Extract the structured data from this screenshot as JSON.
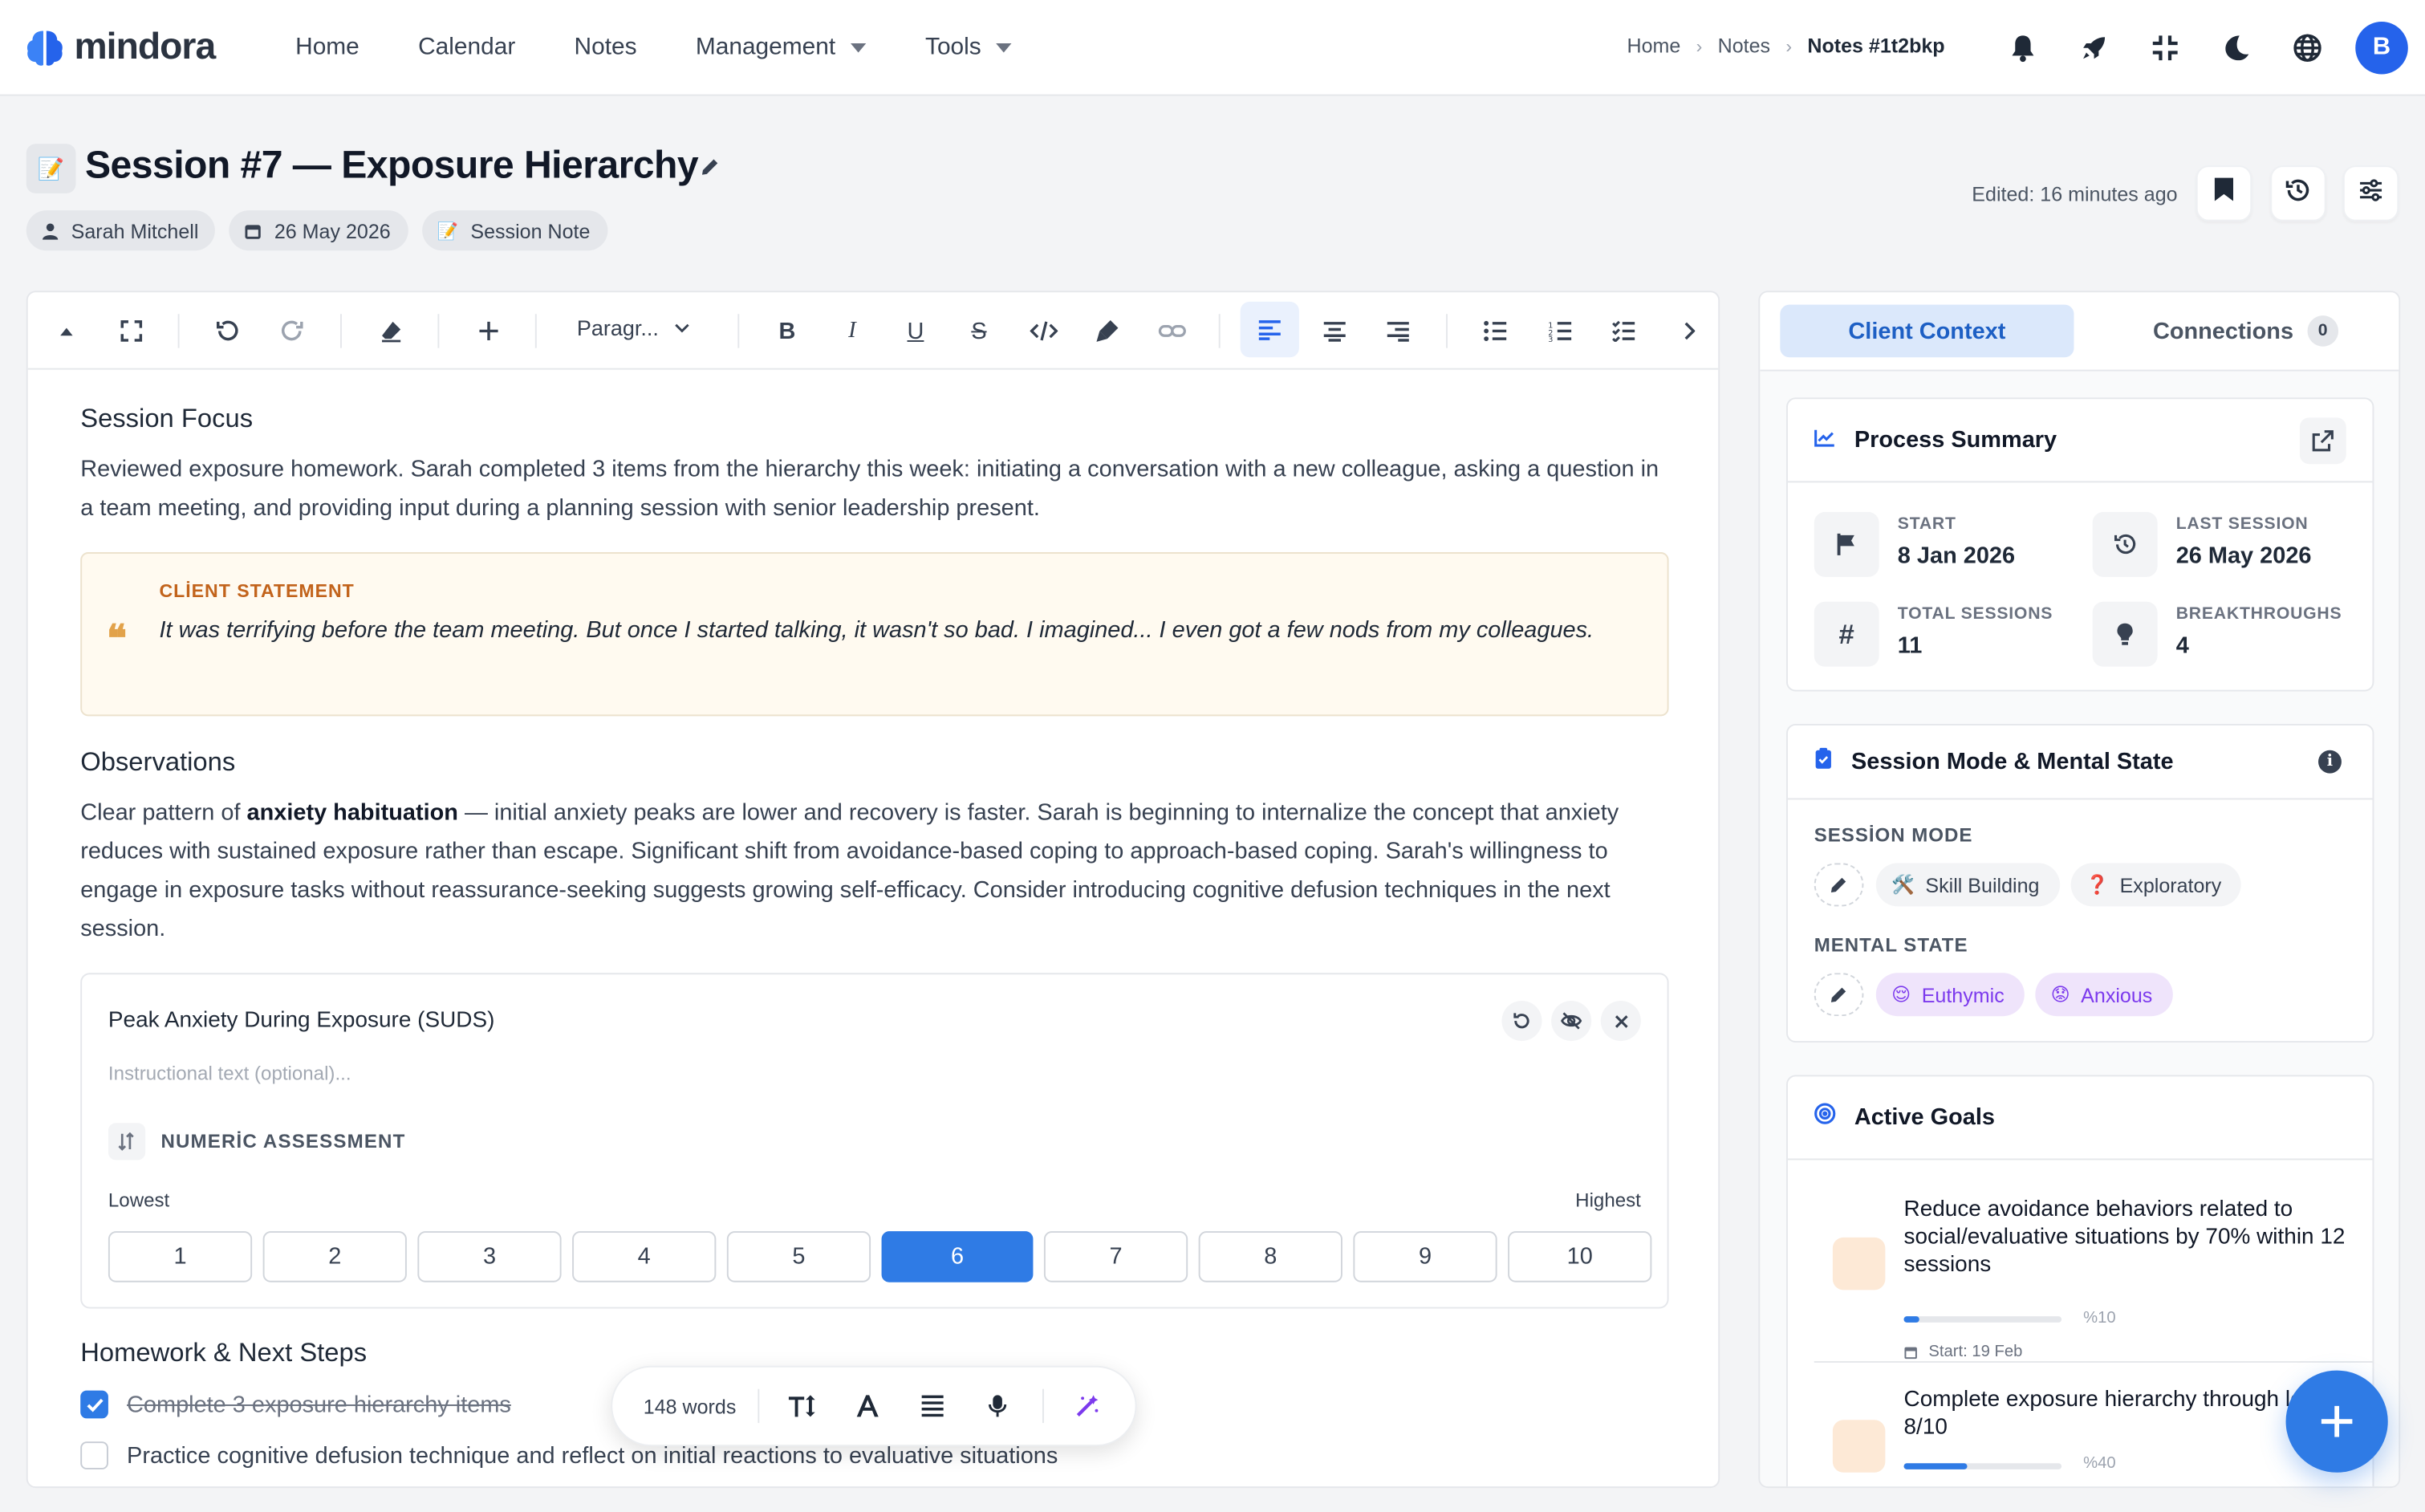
{
  "app": {
    "name": "mindora"
  },
  "nav": {
    "items": [
      {
        "label": "Home",
        "dropdown": false
      },
      {
        "label": "Calendar",
        "dropdown": false
      },
      {
        "label": "Notes",
        "dropdown": false
      },
      {
        "label": "Management",
        "dropdown": true
      },
      {
        "label": "Tools",
        "dropdown": true
      }
    ]
  },
  "breadcrumb": {
    "home": "Home",
    "notes": "Notes",
    "current": "Notes #1t2bkp"
  },
  "user": {
    "initial": "B"
  },
  "note": {
    "title": "Session #7 — Exposure Hierarchy",
    "client": "Sarah Mitchell",
    "date": "26 May 2026",
    "type": "Session Note",
    "edited": "Edited: 16 minutes ago"
  },
  "toolbar": {
    "block_type": "Paragr..."
  },
  "content": {
    "focus_heading": "Session Focus",
    "focus_text": "Reviewed exposure homework. Sarah completed 3 items from the hierarchy this week: initiating a conversation with a new colleague, asking a question in a team meeting, and providing input during a planning session with senior leadership present.",
    "quote_label": "CLİENT STATEMENT",
    "quote_text": "It was terrifying before the team meeting. But once I started talking, it wasn't so bad. I imagined... I even got a few nods from my colleagues.",
    "obs_heading": "Observations",
    "obs_prefix": "Clear pattern of ",
    "obs_bold": "anxiety habituation",
    "obs_rest": " — initial anxiety peaks are lower and recovery is faster. Sarah is beginning to internalize the concept that anxiety reduces with sustained exposure rather than escape. Significant shift from avoidance-based coping to approach-based coping. Sarah's willingness to engage in exposure tasks without reassurance-seeking suggests growing self-efficacy. Consider introducing cognitive defusion techniques in the next session.",
    "assessment": {
      "title": "Peak Anxiety During Exposure (SUDS)",
      "placeholder": "Instructional text (optional)...",
      "kind": "NUMERİC ASSESSMENT",
      "low_label": "Lowest",
      "high_label": "Highest",
      "scale": [
        "1",
        "2",
        "3",
        "4",
        "5",
        "6",
        "7",
        "8",
        "9",
        "10"
      ],
      "selected": "6"
    },
    "hw_heading": "Homework & Next Steps",
    "todos": [
      {
        "text": "Complete 3 exposure hierarchy items",
        "done": true
      },
      {
        "text": "Practice cognitive defusion technique and reflect on initial reactions to evaluative situations",
        "done": false
      }
    ]
  },
  "floatbar": {
    "words": "148 words"
  },
  "sidebar": {
    "tab_context": "Client Context",
    "tab_connections": "Connections",
    "connections_count": "0",
    "process": {
      "title": "Process Summary",
      "start_label": "START",
      "start_value": "8 Jan 2026",
      "last_label": "LAST SESSION",
      "last_value": "26 May 2026",
      "total_label": "TOTAL SESSIONS",
      "total_value": "11",
      "break_label": "BREAKTHROUGHS",
      "break_value": "4"
    },
    "mode": {
      "title": "Session Mode & Mental State",
      "mode_label": "SESSİON MODE",
      "modes": [
        "Skill Building",
        "Exploratory"
      ],
      "state_label": "MENTAL STATE",
      "states": [
        "Euthymic",
        "Anxious"
      ]
    },
    "goals": {
      "title": "Active Goals",
      "items": [
        {
          "text": "Reduce avoidance behaviors related to social/evaluative situations by 70% within 12 sessions",
          "progress": 10,
          "progress_label": "%10",
          "start": "Start: 19 Feb"
        },
        {
          "text": "Complete exposure hierarchy through level 8/10",
          "progress": 40,
          "progress_label": "%40"
        }
      ]
    }
  },
  "colors": {
    "accent": "#2f7be5",
    "quote_bg": "#fffaf0",
    "quote_label": "#c2631b",
    "purple": "#7c3aed"
  }
}
